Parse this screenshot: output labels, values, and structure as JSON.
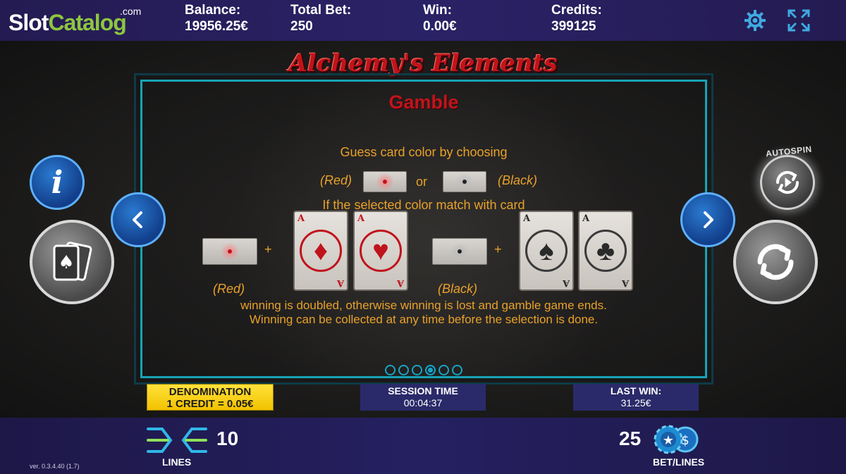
{
  "brand": {
    "logo_part1": "Slot",
    "logo_part2": "Catalog",
    "logo_suffix": ".com"
  },
  "header": {
    "balance_label": "Balance:",
    "balance_value": "19956.25€",
    "total_bet_label": "Total Bet:",
    "total_bet_value": "250",
    "win_label": "Win:",
    "win_value": "0.00€",
    "credits_label": "Credits:",
    "credits_value": "399125"
  },
  "game": {
    "title": "Alchemy's Elements",
    "page_title": "Gamble",
    "line1": "Guess card color by choosing",
    "red_label": "(Red)",
    "or_label": "or",
    "black_label": "(Black)",
    "line2": "If the selected color match with card",
    "plus": "+",
    "card_rank": "A",
    "red_suit_1": "♦",
    "red_suit_2": "♥",
    "black_suit_1": "♠",
    "black_suit_2": "♣",
    "line3": "winning is doubled, otherwise winning is lost and gamble game ends.",
    "line4": "Winning can be collected at any time before the selection is done.",
    "pages_total": 6,
    "active_page": 4
  },
  "side": {
    "autospin_label": "AUTOSPIN"
  },
  "info_strip": {
    "denomination_label": "DENOMINATION",
    "denomination_value": "1 CREDIT = 0.05€",
    "session_label": "SESSION TIME",
    "session_value": "00:04:37",
    "last_win_label": "LAST WIN:",
    "last_win_value": "31.25€"
  },
  "footer": {
    "lines_value": "10",
    "lines_label": "LINES",
    "bet_value": "25",
    "bet_label": "BET/LINES",
    "version": "ver. 0.3.4.40 (1.7)"
  },
  "colors": {
    "accent_blue": "#1aa3c4",
    "title_red": "#c0141c",
    "text_orange": "#e8a12a",
    "denom_yellow": "#f2c200"
  }
}
